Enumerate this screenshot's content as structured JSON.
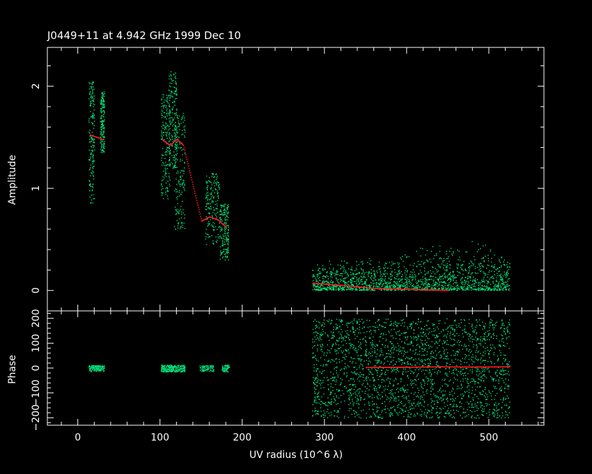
{
  "chart_data": [
    {
      "type": "scatter",
      "panel": "amplitude",
      "title": "J0449+11 at 4.942 GHz 1999 Dec 10",
      "xlabel": "UV radius  (10^6 λ)",
      "ylabel": "Amplitude",
      "xlim": [
        -37,
        567
      ],
      "ylim": [
        -0.2,
        2.38
      ],
      "xticks": [
        0,
        100,
        200,
        300,
        400,
        500
      ],
      "yticks": [
        0,
        1,
        2
      ],
      "grid": false,
      "series": [
        {
          "role": "data",
          "color": "#00e27a",
          "groups": [
            {
              "x": [
                13,
                20
              ],
              "y": [
                0.85,
                2.05
              ]
            },
            {
              "x": [
                27,
                32
              ],
              "y": [
                1.35,
                1.95
              ]
            },
            {
              "x": [
                101,
                112
              ],
              "y": [
                0.9,
                1.95
              ]
            },
            {
              "x": [
                110,
                120
              ],
              "y": [
                1.2,
                2.15
              ]
            },
            {
              "x": [
                117,
                130
              ],
              "y": [
                0.6,
                1.75
              ]
            },
            {
              "x": [
                155,
                172
              ],
              "y": [
                0.45,
                1.15
              ]
            },
            {
              "x": [
                172,
                183
              ],
              "y": [
                0.3,
                0.85
              ]
            },
            {
              "x": [
                285,
                525
              ],
              "y": [
                0.0,
                0.6
              ]
            }
          ]
        },
        {
          "role": "model",
          "color": "#ff1a1a",
          "curve": [
            [
              15,
              1.52
            ],
            [
              30,
              1.48
            ],
            [
              103,
              1.47
            ],
            [
              112,
              1.42
            ],
            [
              120,
              1.48
            ],
            [
              128,
              1.42
            ],
            [
              150,
              0.68
            ],
            [
              160,
              0.72
            ],
            [
              170,
              0.69
            ],
            [
              180,
              0.62
            ],
            [
              285,
              0.07
            ],
            [
              320,
              0.05
            ],
            [
              360,
              0.02
            ],
            [
              400,
              0.01
            ],
            [
              450,
              0.0
            ],
            [
              525,
              0.0
            ]
          ]
        }
      ]
    },
    {
      "type": "scatter",
      "panel": "phase",
      "xlabel": "UV radius  (10^6 λ)",
      "ylabel": "Phase",
      "xlim": [
        -37,
        567
      ],
      "ylim": [
        -230,
        230
      ],
      "xticks": [
        0,
        100,
        200,
        300,
        400,
        500
      ],
      "yticks": [
        -200,
        -100,
        0,
        100,
        200
      ],
      "grid": false,
      "series": [
        {
          "role": "data",
          "color": "#00e27a",
          "groups": [
            {
              "x": [
                13,
                32
              ],
              "y": [
                -12,
                12
              ],
              "n": 160
            },
            {
              "x": [
                101,
                130
              ],
              "y": [
                -14,
                14
              ],
              "n": 260
            },
            {
              "x": [
                148,
                165
              ],
              "y": [
                -12,
                12
              ],
              "n": 90
            },
            {
              "x": [
                175,
                184
              ],
              "y": [
                -14,
                14
              ],
              "n": 60
            },
            {
              "x": [
                285,
                525
              ],
              "y": [
                -200,
                200
              ],
              "n": 2400
            }
          ]
        },
        {
          "role": "model",
          "color": "#ff1a1a",
          "curve": [
            [
              285,
              1
            ],
            [
              350,
              2
            ],
            [
              400,
              3
            ],
            [
              440,
              5
            ],
            [
              480,
              4
            ],
            [
              525,
              5
            ]
          ]
        }
      ]
    }
  ]
}
